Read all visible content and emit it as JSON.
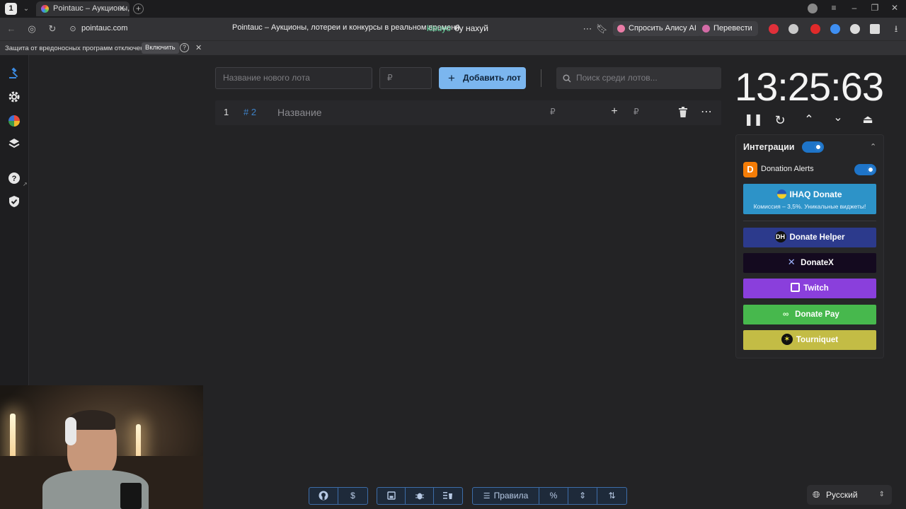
{
  "browser": {
    "tab_counter": "1",
    "tab_title": "Pointauc – Аукционы, л",
    "url": "pointauc.com",
    "page_title": "Pointauc – Аукционы, лотереи и конкурсы в реальном времени",
    "overlay_left": "kisuyo",
    "overlay_right": "бу нахуй",
    "ask_alice": "Спросить Алису AI",
    "translate": "Перевести",
    "warning_text": "Защита от вредоносных программ отключена",
    "warning_enable": "Включить",
    "extension_colors": [
      "#e0303a",
      "#c9c9c9",
      "#e02a2a",
      "#3f8ff2",
      "#dcdcdc",
      "#dcdcdc"
    ]
  },
  "lot_form": {
    "name_placeholder": "Название нового лота",
    "amount_placeholder": "₽",
    "add_button": "Добавить лот",
    "search_placeholder": "Поиск среди лотов..."
  },
  "lots": [
    {
      "index": "1",
      "id": "# 2",
      "name": "Название",
      "amount_symbol": "₽",
      "add_symbol": "₽"
    }
  ],
  "timer": {
    "value": "13:25:63"
  },
  "integrations": {
    "title": "Интеграции",
    "donation_alerts": "Donation Alerts",
    "ihaq_title": "IHAQ Donate",
    "ihaq_sub": "Комиссия – 3,5%. Уникальные виджеты!",
    "services": [
      {
        "label": "Donate Helper",
        "bg": "#2c3a8c"
      },
      {
        "label": "DonateX",
        "bg": "#140a1f"
      },
      {
        "label": "Twitch",
        "bg": "#8a3fdc"
      },
      {
        "label": "Donate Pay",
        "bg": "#47b84d"
      },
      {
        "label": "Tourniquet",
        "bg": "#c3bc45"
      }
    ]
  },
  "bottom_toolbar": {
    "rules": "Правила",
    "dollar": "$",
    "percent": "%"
  },
  "language": {
    "selected": "Русский"
  }
}
